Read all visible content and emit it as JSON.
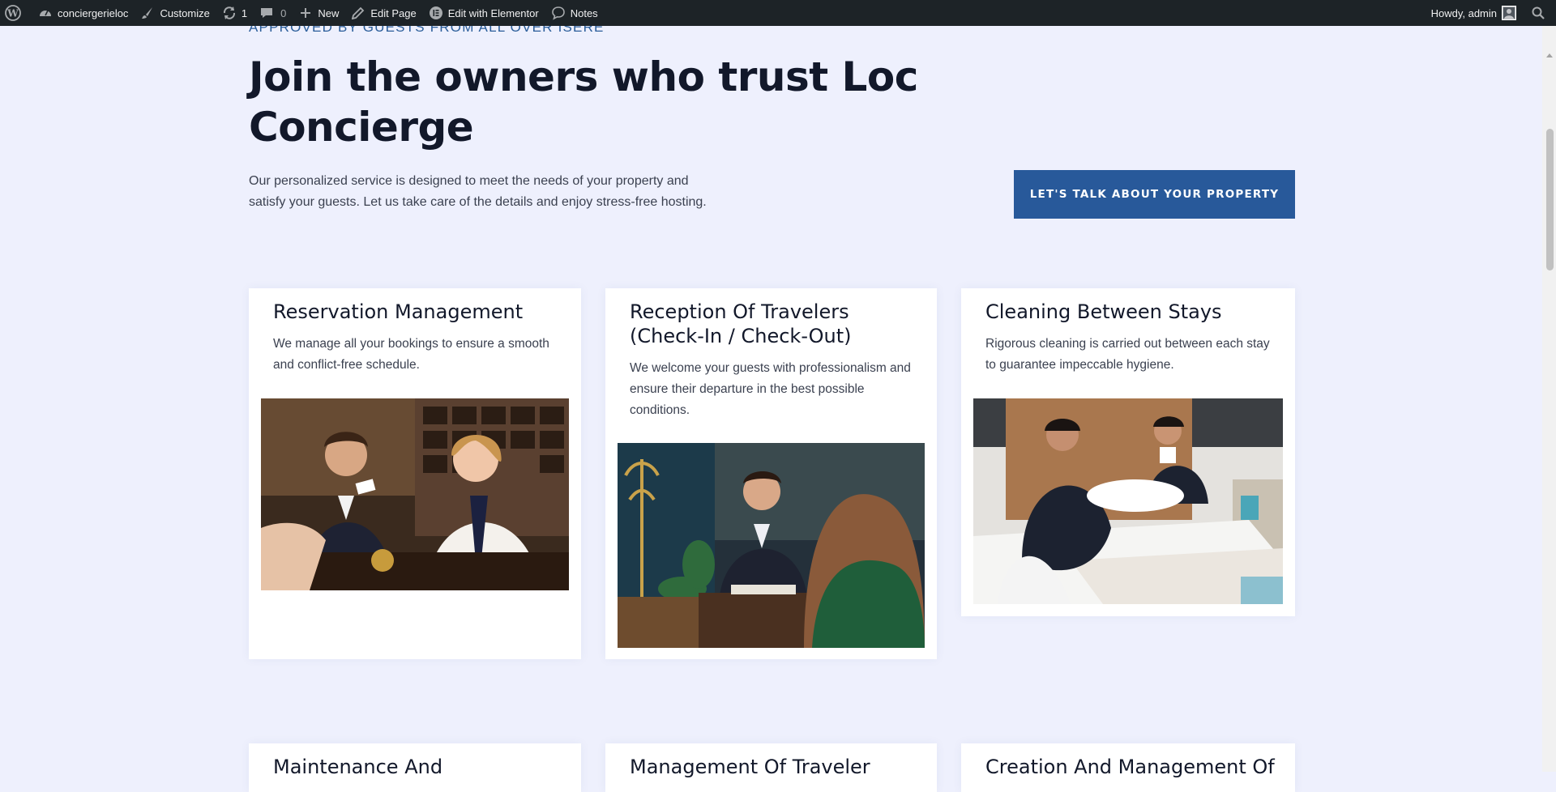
{
  "admin_bar": {
    "site_name": "conciergerieloc",
    "customize": "Customize",
    "updates_count": "1",
    "comments_count": "0",
    "new": "New",
    "edit_page": "Edit Page",
    "edit_elementor": "Edit with Elementor",
    "notes": "Notes",
    "greeting": "Howdy, admin"
  },
  "hero": {
    "kicker": "APPROVED BY GUESTS FROM ALL OVER ISERE",
    "title": "Join the owners who trust Loc Concierge",
    "description": "Our personalized service is designed to meet the needs of your property and satisfy your guests. Let us take care of the details and enjoy stress-free hosting.",
    "cta": "LET'S TALK ABOUT YOUR PROPERTY"
  },
  "services": [
    {
      "title": "Reservation Management",
      "description": "We manage all your bookings to ensure a smooth and conflict-free schedule."
    },
    {
      "title": "Reception Of Travelers (Check-In / Check-Out)",
      "description": "We welcome your guests with professionalism and ensure their departure in the best possible conditions."
    },
    {
      "title": "Cleaning Between Stays",
      "description": "Rigorous cleaning is carried out between each stay to guarantee impeccable hygiene."
    },
    {
      "title": "Maintenance And"
    },
    {
      "title": "Management Of Traveler"
    },
    {
      "title": "Creation And Management Of"
    }
  ],
  "colors": {
    "page_bg": "#eef0fd",
    "accent": "#28599a",
    "kicker": "#2a5d9a",
    "admin_bar": "#1d2327"
  }
}
